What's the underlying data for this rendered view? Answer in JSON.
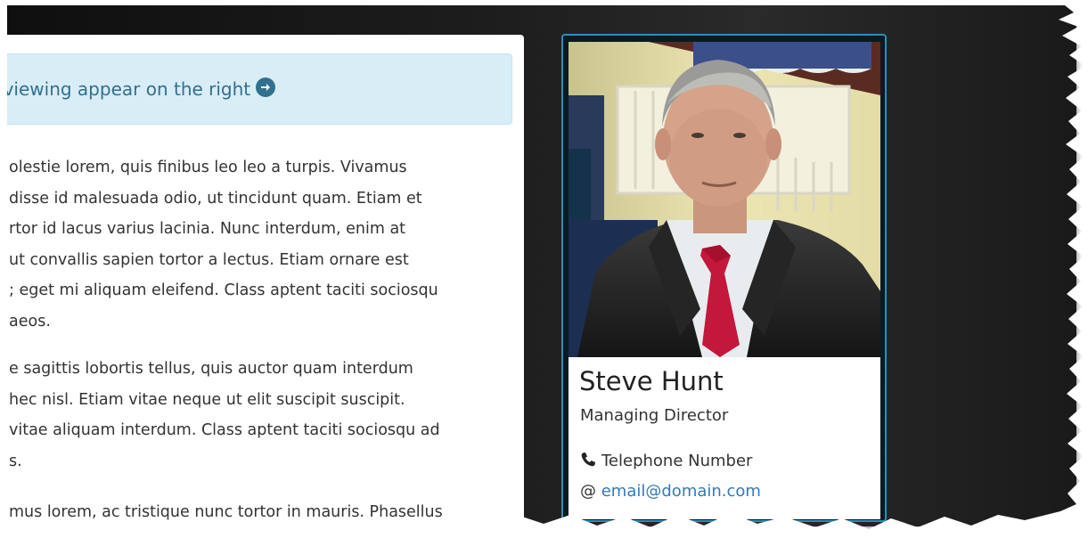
{
  "alert": {
    "text": "r viewing appear on the right",
    "icon": "arrow-circle-right-icon",
    "background": "#d9edf7",
    "text_color": "#31708f"
  },
  "body_text": {
    "paragraph1": [
      "olestie lorem, quis finibus leo leo a turpis. Vivamus",
      "disse id malesuada odio, ut tincidunt quam. Etiam et",
      "rtor id lacus varius lacinia. Nunc interdum, enim at",
      " ut convallis sapien tortor a lectus. Etiam ornare est",
      "; eget mi aliquam eleifend. Class aptent taciti sociosqu",
      "aeos."
    ],
    "paragraph2": [
      "e sagittis lobortis tellus, quis auctor quam interdum",
      "hec nisl. Etiam vitae neque ut elit suscipit suscipit.",
      "vitae aliquam interdum. Class aptent taciti sociosqu ad",
      "s."
    ],
    "paragraph3": [
      "mus lorem, ac tristique nunc tortor in mauris. Phasellus"
    ]
  },
  "profile": {
    "name": "Steve Hunt",
    "title": "Managing Director",
    "phone_label": "Telephone Number",
    "phone_icon": "phone-icon",
    "email_prefix": "@",
    "email": "email@domain.com",
    "card_border_color": "#2a8fb6",
    "link_color": "#337ab7"
  }
}
